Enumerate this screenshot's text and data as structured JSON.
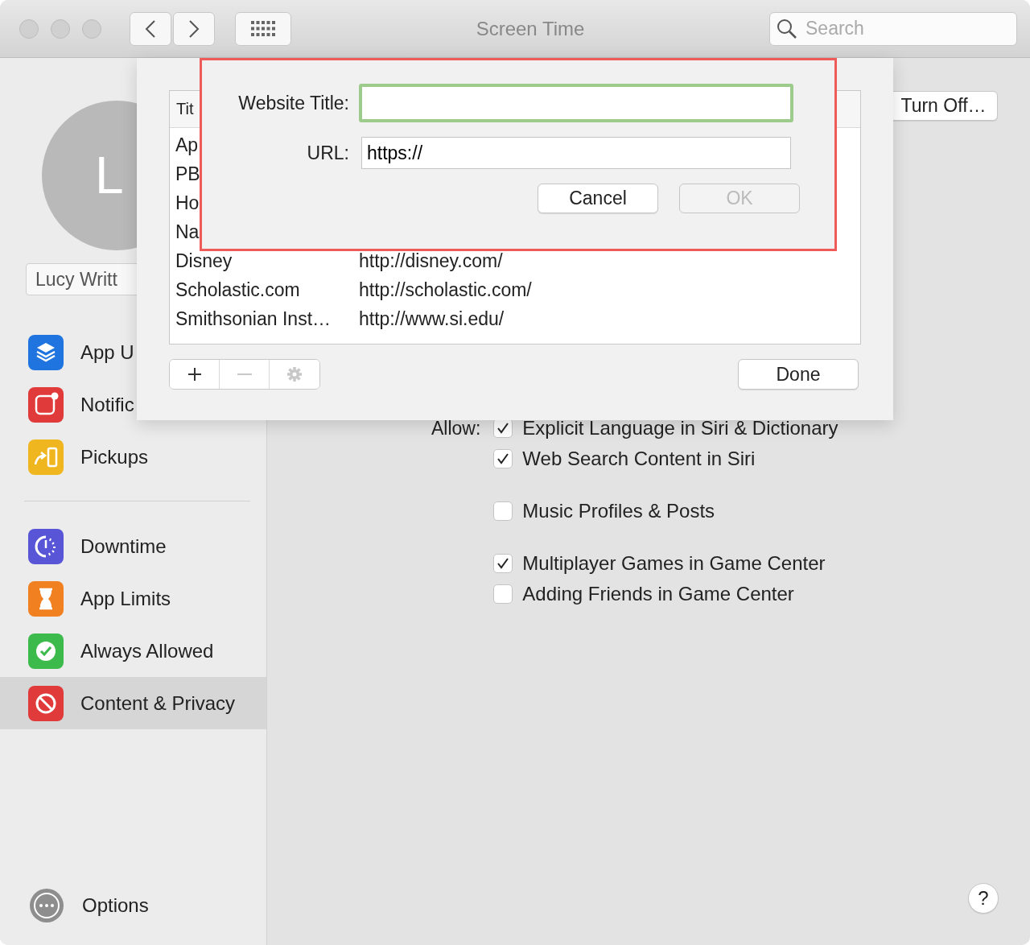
{
  "window": {
    "title": "Screen Time",
    "search": {
      "placeholder": "Search"
    }
  },
  "sidebar": {
    "avatar_initials": "L",
    "user_name": "Lucy Writt",
    "sections": [
      {
        "items": [
          {
            "label": "App U",
            "kind": "layers",
            "selected": false
          },
          {
            "label": "Notific",
            "kind": "notification",
            "selected": false
          },
          {
            "label": "Pickups",
            "kind": "pickup",
            "selected": false
          }
        ]
      },
      {
        "items": [
          {
            "label": "Downtime",
            "kind": "downtime",
            "selected": false
          },
          {
            "label": "App Limits",
            "kind": "hourglass",
            "selected": false
          },
          {
            "label": "Always Allowed",
            "kind": "badge",
            "selected": false
          },
          {
            "label": "Content & Privacy",
            "kind": "block",
            "selected": true
          }
        ]
      }
    ],
    "options": "Options"
  },
  "content": {
    "turn_off_button": "Turn Off…",
    "allow_label": "Allow:",
    "option_groups": [
      {
        "items": [
          {
            "label": "Explicit Language in Siri & Dictionary",
            "checked": true
          },
          {
            "label": "Web Search Content in Siri",
            "checked": true
          }
        ]
      },
      {
        "items": [
          {
            "label": "Music Profiles & Posts",
            "checked": false
          }
        ]
      },
      {
        "items": [
          {
            "label": "Multiplayer Games in Game Center",
            "checked": true
          },
          {
            "label": "Adding Friends in Game Center",
            "checked": false
          }
        ]
      }
    ],
    "help_button": "?"
  },
  "sheet": {
    "table": {
      "columns": [
        "Tit"
      ],
      "rows": [
        {
          "title": "Ap"
        },
        {
          "title": "PB"
        },
        {
          "title": "Ho"
        },
        {
          "title": "Na"
        },
        {
          "title": "Disney",
          "url": "http://disney.com/"
        },
        {
          "title": "Scholastic.com",
          "url": "http://scholastic.com/"
        },
        {
          "title": "Smithsonian Inst…",
          "url": "http://www.si.edu/"
        }
      ]
    },
    "tools": [
      {
        "kind": "add",
        "disabled": false
      },
      {
        "kind": "remove",
        "disabled": true
      },
      {
        "kind": "gear",
        "disabled": true
      }
    ],
    "done_button": "Done"
  },
  "prompt": {
    "fields": [
      {
        "label": "Website Title:",
        "focused": true
      },
      {
        "label": "URL:",
        "value": "https://",
        "focused": false
      }
    ],
    "buttons": [
      {
        "label": "Cancel",
        "disabled": false
      },
      {
        "label": "OK",
        "disabled": true
      }
    ]
  }
}
